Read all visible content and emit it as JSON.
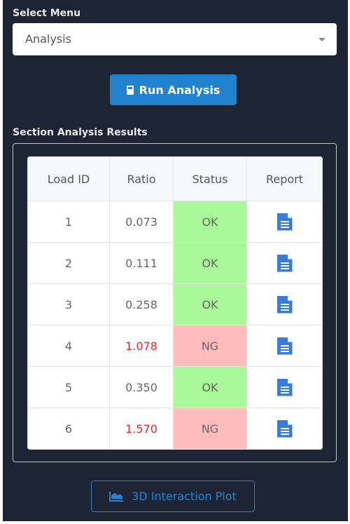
{
  "select_menu": {
    "label": "Select Menu",
    "value": "Analysis"
  },
  "run_button": {
    "label": "Run Analysis",
    "icon": "calculator-icon"
  },
  "results": {
    "title": "Section Analysis Results",
    "columns": [
      "Load ID",
      "Ratio",
      "Status",
      "Report"
    ],
    "rows": [
      {
        "load_id": "1",
        "ratio": "0.073",
        "status": "OK"
      },
      {
        "load_id": "2",
        "ratio": "0.111",
        "status": "OK"
      },
      {
        "load_id": "3",
        "ratio": "0.258",
        "status": "OK"
      },
      {
        "load_id": "4",
        "ratio": "1.078",
        "status": "NG"
      },
      {
        "load_id": "5",
        "ratio": "0.350",
        "status": "OK"
      },
      {
        "load_id": "6",
        "ratio": "1.570",
        "status": "NG"
      }
    ],
    "colors": {
      "ok_bg": "#a8f799",
      "ng_bg": "#ffbcbc",
      "ng_text": "#ee2a2a"
    }
  },
  "plot_button": {
    "label": "3D Interaction Plot",
    "icon": "area-chart-icon"
  }
}
